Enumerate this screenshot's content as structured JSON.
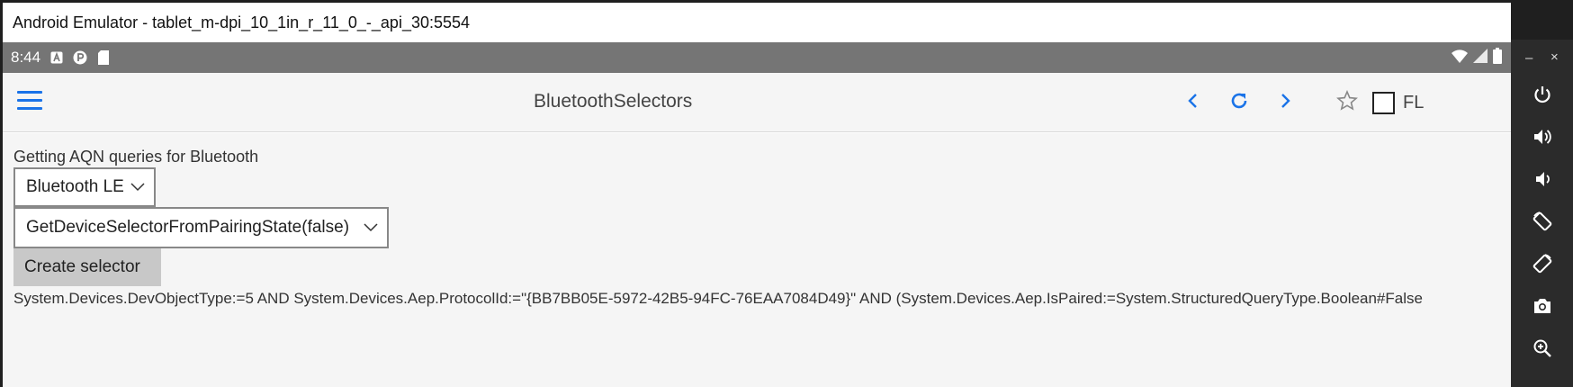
{
  "window": {
    "title": "Android Emulator - tablet_m-dpi_10_1in_r_11_0_-_api_30:5554"
  },
  "status_bar": {
    "time": "8:44",
    "left_icons": [
      "a-notification-icon",
      "p-notification-icon",
      "sd-card-icon"
    ],
    "right_icons": [
      "wifi-icon",
      "cell-signal-icon",
      "battery-icon"
    ]
  },
  "app_bar": {
    "title": "BluetoothSelectors",
    "fl_label": "FL"
  },
  "content": {
    "heading": "Getting AQN queries for Bluetooth",
    "transport_select": "Bluetooth LE",
    "method_select": "GetDeviceSelectorFromPairingState(false)",
    "create_button": "Create selector",
    "result": "System.Devices.DevObjectType:=5 AND System.Devices.Aep.ProtocolId:=\"{BB7BB05E-5972-42B5-94FC-76EAA7084D49}\" AND (System.Devices.Aep.IsPaired:=System.StructuredQueryType.Boolean#False"
  },
  "emulator_controls": {
    "minimize": "–",
    "close": "×",
    "tools": [
      "power-icon",
      "volume-up-icon",
      "volume-down-icon",
      "rotate-left-icon",
      "rotate-right-icon",
      "camera-icon",
      "zoom-icon"
    ]
  },
  "colors": {
    "accent": "#1a73e8",
    "status_bar": "#757575",
    "app_background": "#f5f5f5",
    "toolbar": "#2b2b2b"
  }
}
